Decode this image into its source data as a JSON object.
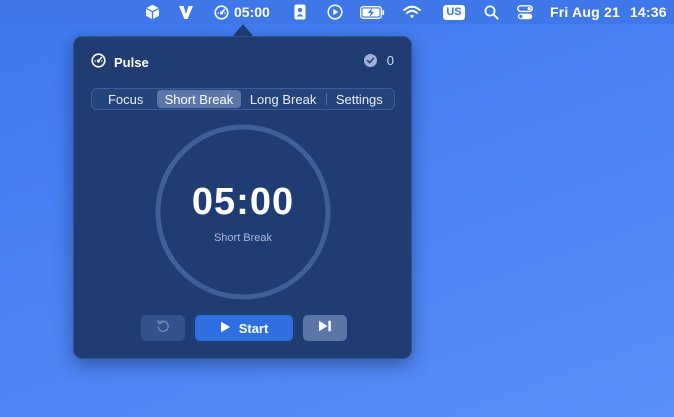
{
  "menubar": {
    "icons": [
      "cube-icon",
      "vectorworks-v-icon",
      "pulse-timer-icon",
      "contacts-icon",
      "play-circle-icon",
      "battery-charging-icon",
      "wifi-icon",
      "input-source",
      "search-icon",
      "control-center-icon"
    ],
    "timer_text": "05:00",
    "input_source": "US",
    "date": "Fri Aug 21",
    "time": "14:36"
  },
  "popover": {
    "app_name": "Pulse",
    "completed_count": "0",
    "tabs": [
      {
        "label": "Focus",
        "active": false
      },
      {
        "label": "Short Break",
        "active": true
      },
      {
        "label": "Long Break",
        "active": false
      },
      {
        "label": "Settings",
        "active": false
      }
    ],
    "timer": {
      "time": "05:00",
      "mode": "Short Break",
      "progress": 0
    },
    "controls": {
      "start_label": "Start"
    }
  },
  "colors": {
    "desktop": "#4a82f2",
    "menubar": "#3f77e8",
    "popover_bg": "#1f3d73",
    "accent": "#2f6ee0",
    "active_tab": "#5a77a8",
    "ring": "#3e5f97"
  }
}
